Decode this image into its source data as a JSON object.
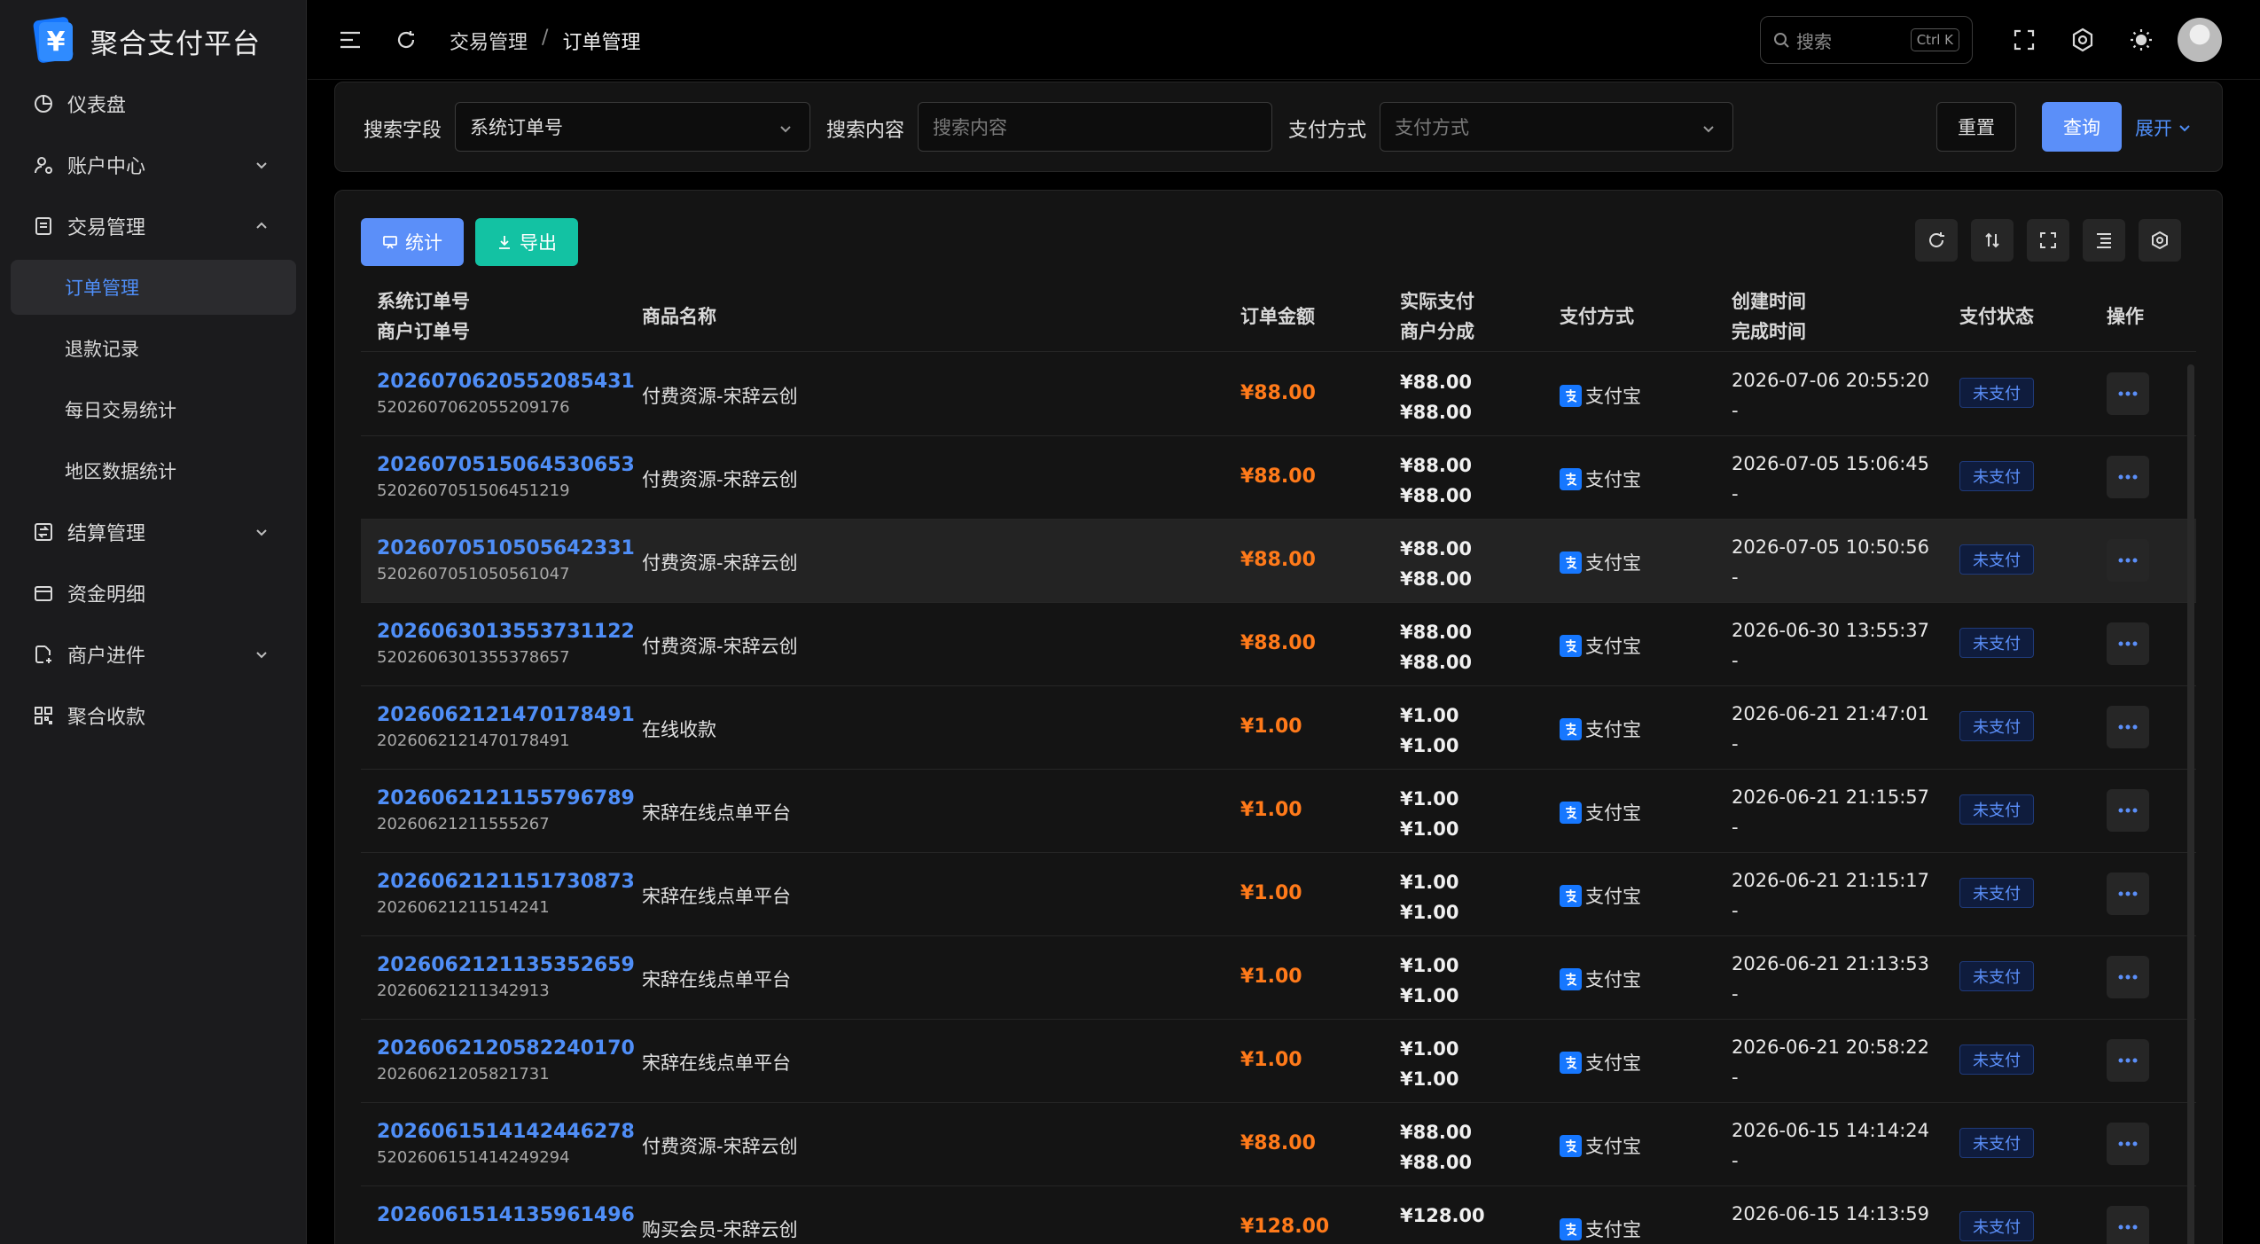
{
  "app": {
    "title": "聚合支付平台",
    "logo_glyph": "¥"
  },
  "sidebar": {
    "items": [
      {
        "label": "仪表盘",
        "icon": "dashboard-icon"
      },
      {
        "label": "账户中心",
        "icon": "user-settings-icon",
        "has_children": true
      },
      {
        "label": "交易管理",
        "icon": "transaction-icon",
        "has_children": true,
        "expanded": true
      },
      {
        "label": "订单管理",
        "sub": true,
        "active": true
      },
      {
        "label": "退款记录",
        "sub": true
      },
      {
        "label": "每日交易统计",
        "sub": true
      },
      {
        "label": "地区数据统计",
        "sub": true
      },
      {
        "label": "结算管理",
        "icon": "settlement-icon",
        "has_children": true
      },
      {
        "label": "资金明细",
        "icon": "wallet-icon"
      },
      {
        "label": "商户进件",
        "icon": "merchant-apply-icon",
        "has_children": true
      },
      {
        "label": "聚合收款",
        "icon": "qrcode-icon"
      }
    ]
  },
  "header": {
    "breadcrumb": [
      "交易管理",
      "订单管理"
    ],
    "search_placeholder": "搜索",
    "search_shortcut": "Ctrl K"
  },
  "filter": {
    "field_label": "搜索字段",
    "field_value": "系统订单号",
    "content_label": "搜索内容",
    "content_placeholder": "搜索内容",
    "paymethod_label": "支付方式",
    "paymethod_placeholder": "支付方式",
    "reset_label": "重置",
    "query_label": "查询",
    "expand_label": "展开"
  },
  "toolbar": {
    "stat_label": "统计",
    "export_label": "导出"
  },
  "table": {
    "headers": {
      "order_no": "系统订单号",
      "merchant_no": "商户订单号",
      "goods": "商品名称",
      "amount": "订单金额",
      "paid": "实际支付",
      "share": "商户分成",
      "pay_method": "支付方式",
      "created": "创建时间",
      "finished": "完成时间",
      "status": "支付状态",
      "ops": "操作"
    },
    "rows": [
      {
        "order_no": "2026070620552085431",
        "merchant_no": "5202607062055209176",
        "goods": "付费资源-宋辞云创",
        "amount": "¥88.00",
        "paid": "¥88.00",
        "share": "¥88.00",
        "pay_method": "支付宝",
        "created": "2026-07-06 20:55:20",
        "finished": "-",
        "status": "未支付"
      },
      {
        "order_no": "2026070515064530653",
        "merchant_no": "5202607051506451219",
        "goods": "付费资源-宋辞云创",
        "amount": "¥88.00",
        "paid": "¥88.00",
        "share": "¥88.00",
        "pay_method": "支付宝",
        "created": "2026-07-05 15:06:45",
        "finished": "-",
        "status": "未支付"
      },
      {
        "order_no": "2026070510505642331",
        "merchant_no": "5202607051050561047",
        "goods": "付费资源-宋辞云创",
        "amount": "¥88.00",
        "paid": "¥88.00",
        "share": "¥88.00",
        "pay_method": "支付宝",
        "created": "2026-07-05 10:50:56",
        "finished": "-",
        "status": "未支付",
        "highlight": true
      },
      {
        "order_no": "2026063013553731122",
        "merchant_no": "5202606301355378657",
        "goods": "付费资源-宋辞云创",
        "amount": "¥88.00",
        "paid": "¥88.00",
        "share": "¥88.00",
        "pay_method": "支付宝",
        "created": "2026-06-30 13:55:37",
        "finished": "-",
        "status": "未支付"
      },
      {
        "order_no": "2026062121470178491",
        "merchant_no": "2026062121470178491",
        "goods": "在线收款",
        "amount": "¥1.00",
        "paid": "¥1.00",
        "share": "¥1.00",
        "pay_method": "支付宝",
        "created": "2026-06-21 21:47:01",
        "finished": "-",
        "status": "未支付"
      },
      {
        "order_no": "2026062121155796789",
        "merchant_no": "20260621211555267",
        "goods": "宋辞在线点单平台",
        "amount": "¥1.00",
        "paid": "¥1.00",
        "share": "¥1.00",
        "pay_method": "支付宝",
        "created": "2026-06-21 21:15:57",
        "finished": "-",
        "status": "未支付"
      },
      {
        "order_no": "2026062121151730873",
        "merchant_no": "20260621211514241",
        "goods": "宋辞在线点单平台",
        "amount": "¥1.00",
        "paid": "¥1.00",
        "share": "¥1.00",
        "pay_method": "支付宝",
        "created": "2026-06-21 21:15:17",
        "finished": "-",
        "status": "未支付"
      },
      {
        "order_no": "2026062121135352659",
        "merchant_no": "20260621211342913",
        "goods": "宋辞在线点单平台",
        "amount": "¥1.00",
        "paid": "¥1.00",
        "share": "¥1.00",
        "pay_method": "支付宝",
        "created": "2026-06-21 21:13:53",
        "finished": "-",
        "status": "未支付"
      },
      {
        "order_no": "2026062120582240170",
        "merchant_no": "20260621205821731",
        "goods": "宋辞在线点单平台",
        "amount": "¥1.00",
        "paid": "¥1.00",
        "share": "¥1.00",
        "pay_method": "支付宝",
        "created": "2026-06-21 20:58:22",
        "finished": "-",
        "status": "未支付"
      },
      {
        "order_no": "2026061514142446278",
        "merchant_no": "5202606151414249294",
        "goods": "付费资源-宋辞云创",
        "amount": "¥88.00",
        "paid": "¥88.00",
        "share": "¥88.00",
        "pay_method": "支付宝",
        "created": "2026-06-15 14:14:24",
        "finished": "-",
        "status": "未支付"
      },
      {
        "order_no": "2026061514135961496",
        "merchant_no": "",
        "goods": "购买会员-宋辞云创",
        "amount": "¥128.00",
        "paid": "¥128.00",
        "share": "",
        "pay_method": "支付宝",
        "created": "2026-06-15 14:13:59",
        "finished": "",
        "status": "未支付"
      }
    ]
  },
  "colors": {
    "accent": "#5b8ff9",
    "link": "#4f8ef7",
    "amount": "#ff7a1a",
    "export": "#13c2a3",
    "alipay": "#1677ff"
  }
}
